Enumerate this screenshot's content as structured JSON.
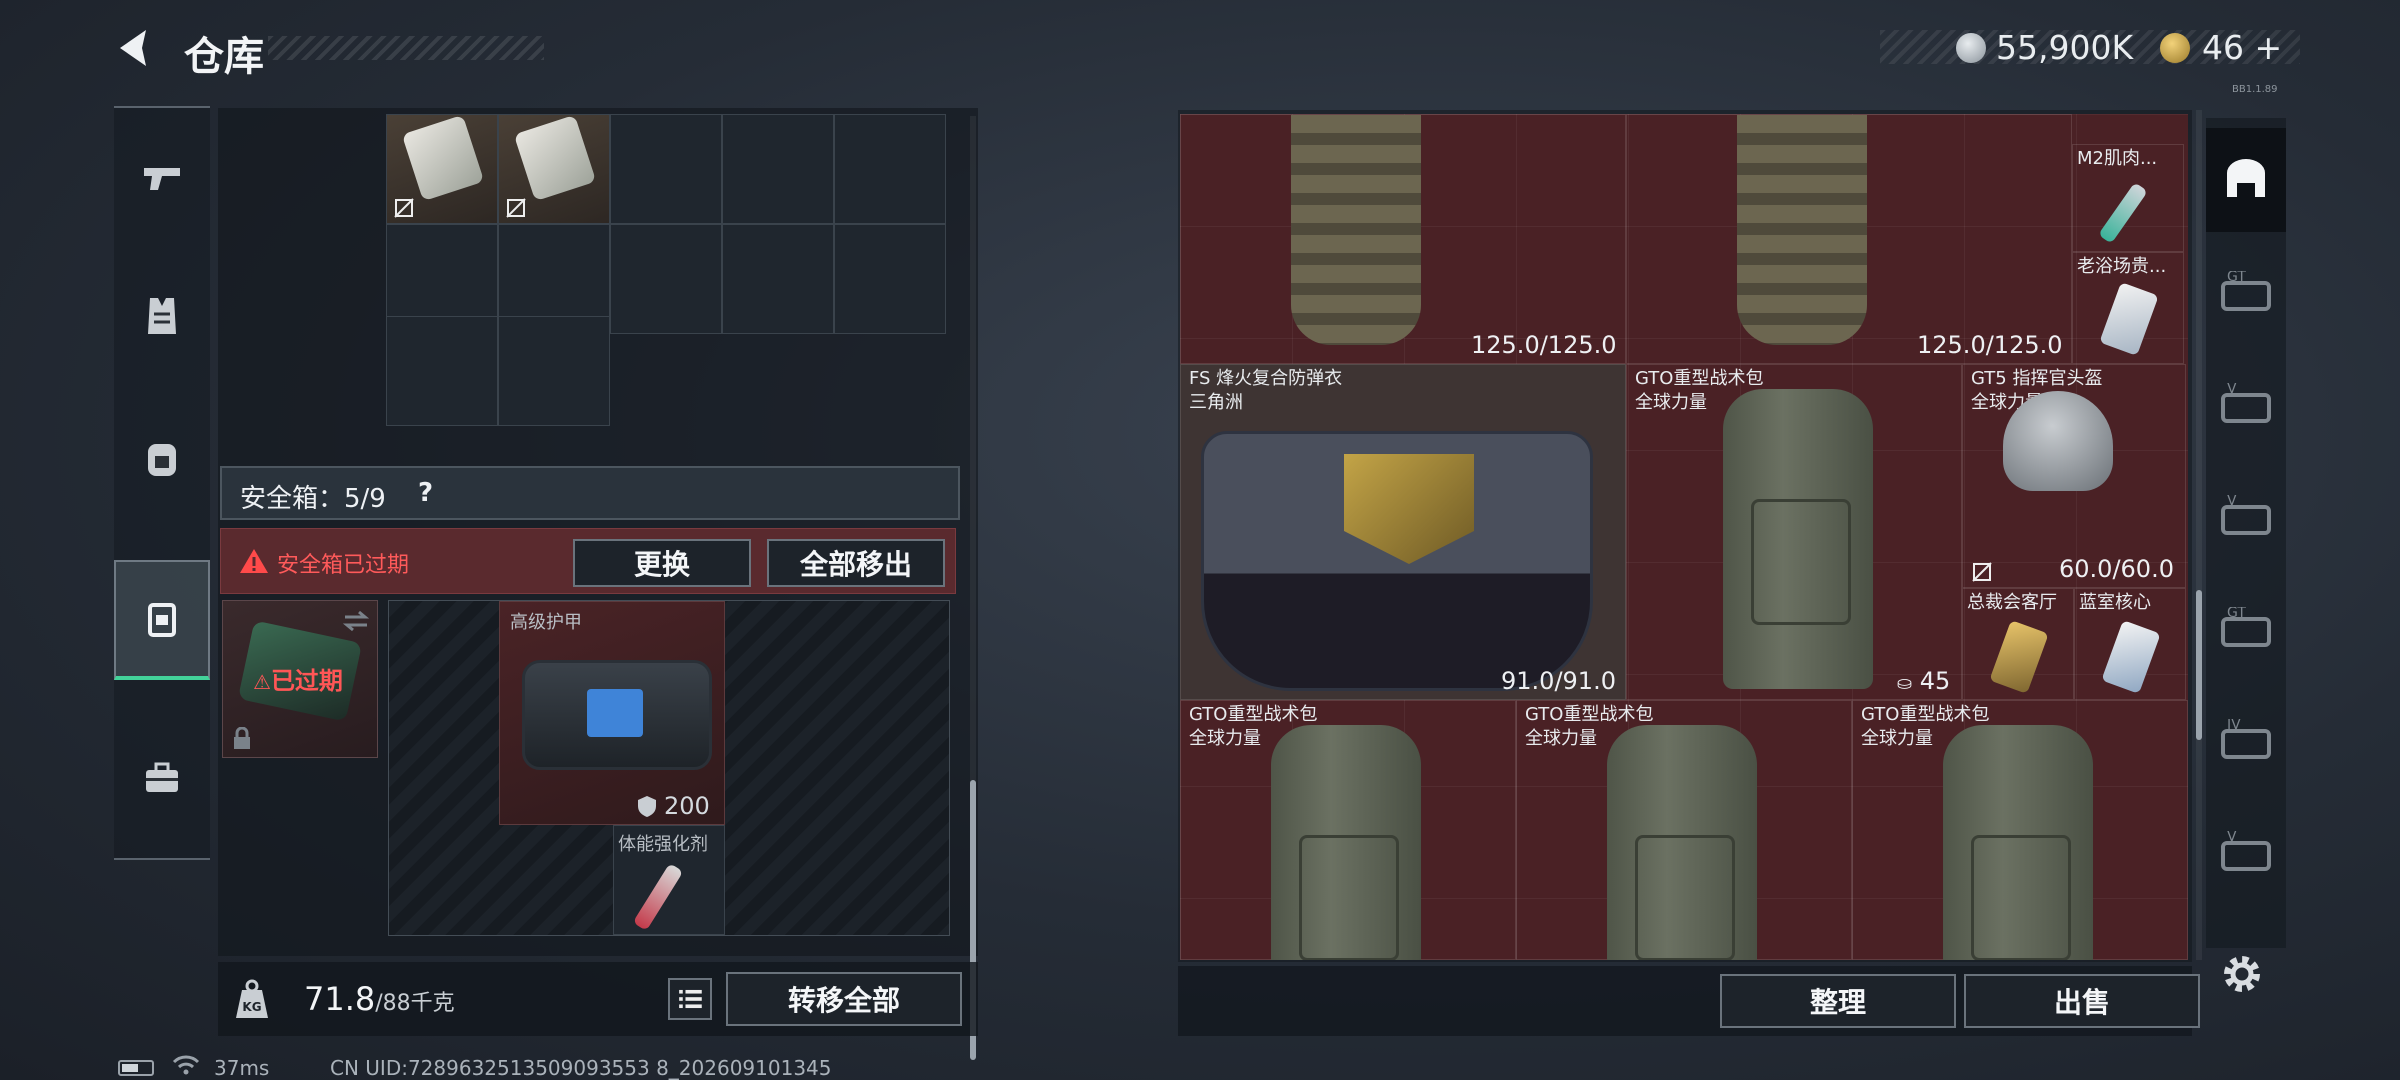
{
  "header": {
    "title": "仓库",
    "coins": "55,900K",
    "gems": "46",
    "gems_plus": "+",
    "version_tiny": "BB1.1.89"
  },
  "left_sidebar": {
    "items": [
      {
        "icon": "pistol-icon"
      },
      {
        "icon": "vest-icon"
      },
      {
        "icon": "backpack-icon"
      },
      {
        "icon": "safebox-icon",
        "active": true
      },
      {
        "icon": "toolbox-icon"
      }
    ]
  },
  "safebox": {
    "label": "安全箱：5/9",
    "help": "?",
    "alert": "安全箱已过期",
    "replace_label": "更换",
    "remove_all_label": "全部移出",
    "expired_tag": "已过期",
    "armor_name": "高级护甲",
    "armor_durability": "200",
    "stim_name": "体能强化剂"
  },
  "weight": {
    "value": "71.8",
    "max": "/88千克",
    "transfer_all_label": "转移全部"
  },
  "right_items": {
    "vest_top_1_durability": "125.0/125.0",
    "vest_top_2_durability": "125.0/125.0",
    "m2_name": "M2肌肉...",
    "old_bath_name": "老浴场贵...",
    "fs_name": "FS 烽火复合防弹衣",
    "fs_sub": "三角洲",
    "fs_durability": "91.0/91.0",
    "gto_name": "GTO重型战术包",
    "gto_sub": "全球力量",
    "gto_capacity": "45",
    "gt5_name": "GT5 指挥官头盔",
    "gt5_sub": "全球力量",
    "gt5_durability": "60.0/60.0",
    "card1_name": "总裁会客厅",
    "card2_name": "蓝室核心",
    "pack1_name": "GTO重型战术包",
    "pack1_sub": "全球力量",
    "pack2_name": "GTO重型战术包",
    "pack2_sub": "全球力量",
    "pack3_name": "GTO重型战术包",
    "pack3_sub": "全球力量"
  },
  "right_tabs": [
    {
      "label": ""
    },
    {
      "label": "GT"
    },
    {
      "label": "V"
    },
    {
      "label": "V"
    },
    {
      "label": "GT"
    },
    {
      "label": "IV"
    },
    {
      "label": "V"
    }
  ],
  "right_actions": {
    "sort_label": "整理",
    "sell_label": "出售"
  },
  "status": {
    "ping": "37ms",
    "uid": "CN UID:7289632513509093553 8_202609101345"
  },
  "colors": {
    "accent_green": "#43d39a",
    "alert_red": "#ff5a5a",
    "grid_red": "#4a2125"
  }
}
